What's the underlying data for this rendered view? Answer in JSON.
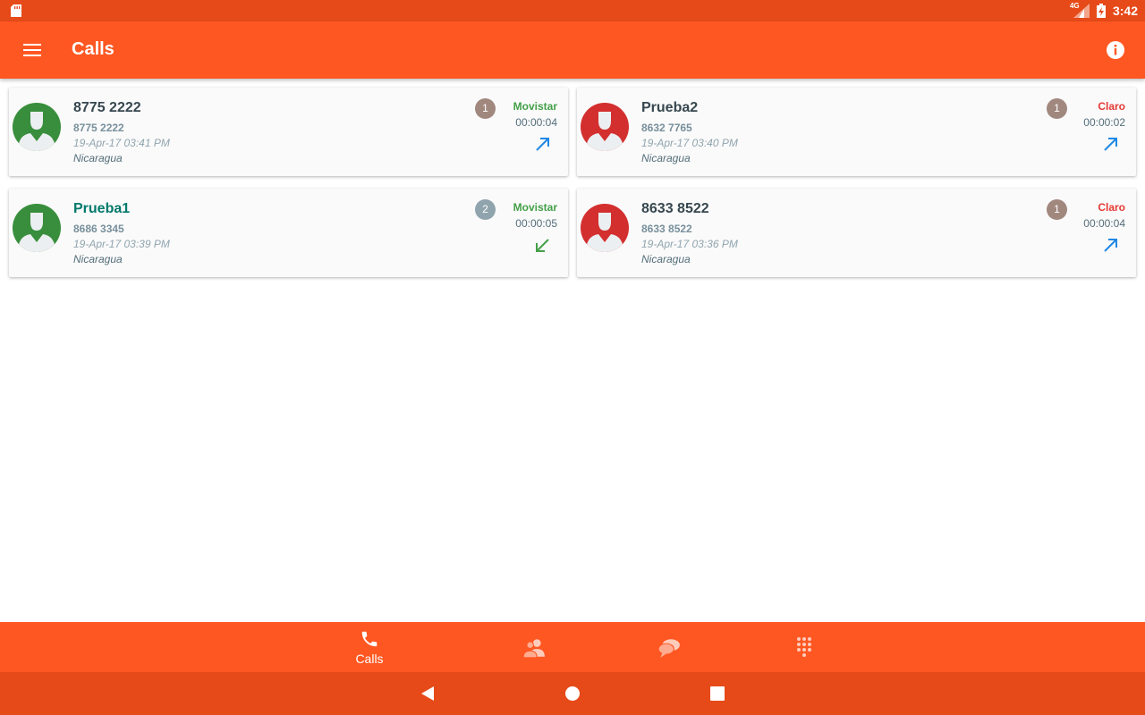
{
  "status_bar": {
    "network": "4G",
    "time": "3:42"
  },
  "app_bar": {
    "title": "Calls"
  },
  "calls": [
    {
      "name": "8775 2222",
      "number": "8775 2222",
      "date": "19-Apr-17 03:41 PM",
      "country": "Nicaragua",
      "count": "1",
      "carrier": "Movistar",
      "duration": "00:00:04",
      "direction": "outgoing"
    },
    {
      "name": "Prueba2",
      "number": "8632 7765",
      "date": "19-Apr-17 03:40 PM",
      "country": "Nicaragua",
      "count": "1",
      "carrier": "Claro",
      "duration": "00:00:02",
      "direction": "outgoing"
    },
    {
      "name": "Prueba1",
      "number": "8686 3345",
      "date": "19-Apr-17 03:39 PM",
      "country": "Nicaragua",
      "count": "2",
      "carrier": "Movistar",
      "duration": "00:00:05",
      "direction": "incoming"
    },
    {
      "name": "8633 8522",
      "number": "8633 8522",
      "date": "19-Apr-17 03:36 PM",
      "country": "Nicaragua",
      "count": "1",
      "carrier": "Claro",
      "duration": "00:00:04",
      "direction": "outgoing"
    }
  ],
  "bottom_nav": {
    "calls_label": "Calls"
  },
  "colors": {
    "primary": "#ff5722",
    "primary_dark": "#e64a19",
    "movistar": "#43a047",
    "claro": "#e53935",
    "avatar_movistar": "#388e3c",
    "avatar_claro": "#d32f2f",
    "outgoing_arrow": "#1e88e5",
    "incoming_arrow": "#43a047"
  },
  "icons": {
    "menu": "menu-icon",
    "info": "info-icon",
    "calls_tab": "phone-icon",
    "contacts_tab": "contacts-icon",
    "messages_tab": "chat-icon",
    "dialpad_tab": "dialpad-icon"
  }
}
